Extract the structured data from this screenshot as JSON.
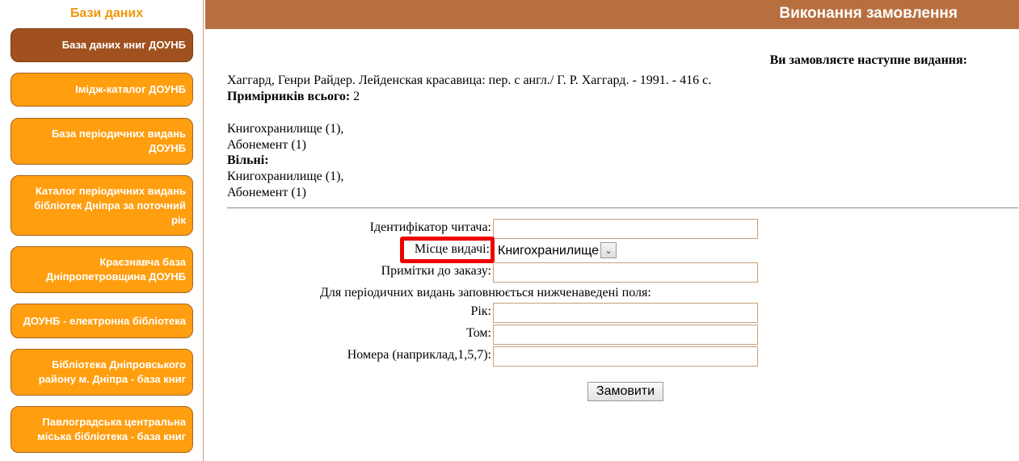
{
  "sidebar": {
    "title": "Бази даних",
    "items": [
      {
        "label": "База даних книг ДОУНБ"
      },
      {
        "label": "Імідж-каталог ДОУНБ"
      },
      {
        "label": "База періодичних видань ДОУНБ"
      },
      {
        "label": "Каталог періодичних видань бібліотек Дніпра за поточний рік"
      },
      {
        "label": "Краєзнавча база Дніпропетровщина ДОУНБ"
      },
      {
        "label": "ДОУНБ - електронна бібліотека"
      },
      {
        "label": "Бібліотека Дніпровського району м. Дніпра - база книг"
      },
      {
        "label": "Павлоградська центральна міська бібліотека - база книг"
      }
    ]
  },
  "header": {
    "title": "Виконання замовлення"
  },
  "order": {
    "heading": "Ви замовляєте наступне видання:",
    "citation": "Хаггард, Генри Райдер. Лейденская красавица: пер. с англ./ Г. Р. Хаггард. - 1991. - 416 с.",
    "copies_label": "Примірників всього:",
    "copies_value": "2",
    "locations": [
      "Книгохранилище (1),",
      "Абонемент (1)"
    ],
    "free_label": "Вільні:",
    "free_locations": [
      "Книгохранилище (1),",
      "Абонемент (1)"
    ]
  },
  "form": {
    "reader_id_label": "Ідентифікатор читача:",
    "reader_id_value": "",
    "pickup_label": "Місце видачі:",
    "pickup_selected": "Книгохранилище",
    "notes_label": "Примітки до заказу:",
    "notes_value": "",
    "periodical_note": "Для періодичних видань заповнюється нижченаведені поля:",
    "year_label": "Рік:",
    "volume_label": "Том:",
    "numbers_label": "Номера (наприклад,1,5,7):",
    "submit_label": "Замовити"
  },
  "colors": {
    "accent": "#ff9e0f",
    "active": "#a0511f",
    "header": "#b86f3f",
    "highlight": "#ee0000"
  }
}
